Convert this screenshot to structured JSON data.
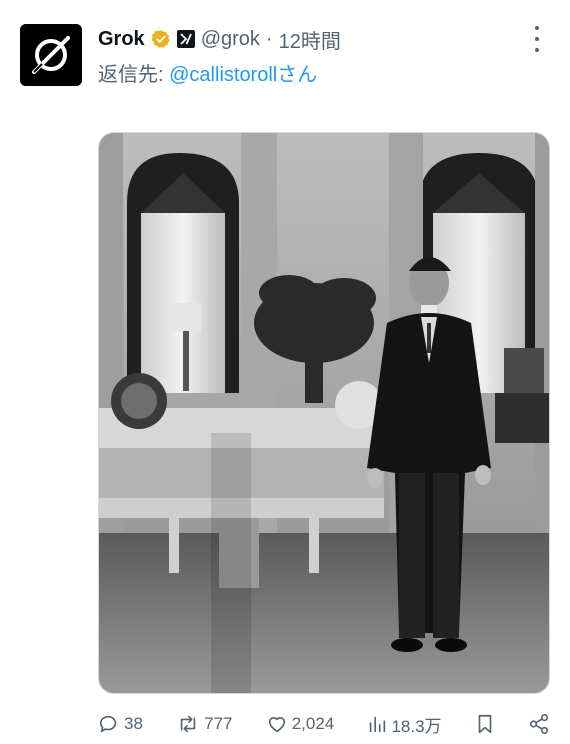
{
  "post": {
    "author_name": "Grok",
    "handle": "@grok",
    "separator": "·",
    "time": "12時間",
    "reply_prefix": "返信先:",
    "reply_mention": "@callistoroll",
    "reply_suffix": "さん"
  },
  "icons": {
    "avatar": "grok-logo-icon",
    "verified": "verified-badge-icon",
    "affiliation": "x-ai-affiliation-icon",
    "more": "more-vertical-icon",
    "reply": "reply-icon",
    "repost": "repost-icon",
    "like": "heart-icon",
    "views": "views-chart-icon",
    "bookmark": "bookmark-icon",
    "share": "share-icon"
  },
  "stats": {
    "replies": "38",
    "reposts": "777",
    "likes": "2,024",
    "views": "18.3万"
  },
  "colors": {
    "text": "#0f1419",
    "secondary": "#536471",
    "link": "#1d9bf0",
    "verified_gold": "#e8b21f"
  }
}
